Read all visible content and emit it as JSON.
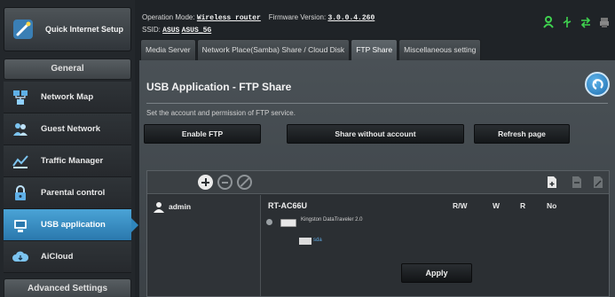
{
  "sidebar": {
    "quick_setup_label": "Quick Internet Setup",
    "general_header": "General",
    "items": [
      {
        "label": "Network Map",
        "icon": "network-map-icon"
      },
      {
        "label": "Guest Network",
        "icon": "guest-network-icon"
      },
      {
        "label": "Traffic Manager",
        "icon": "traffic-manager-icon"
      },
      {
        "label": "Parental control",
        "icon": "parental-control-icon"
      },
      {
        "label": "USB application",
        "icon": "usb-application-icon",
        "active": true
      },
      {
        "label": "AiCloud",
        "icon": "aicloud-icon"
      }
    ],
    "advanced_header": "Advanced Settings"
  },
  "header": {
    "op_mode_label": "Operation Mode:",
    "op_mode_value": "Wireless router",
    "firmware_label": "Firmware Version:",
    "firmware_value": "3.0.0.4.260",
    "ssid_label": "SSID:",
    "ssid_1": "ASUS",
    "ssid_2": "ASUS_5G",
    "status_icons": [
      "user-status-icon",
      "usb-status-icon",
      "network-status-icon",
      "printer-status-icon"
    ]
  },
  "tabs": [
    {
      "label": "Media Server"
    },
    {
      "label": "Network Place(Samba) Share / Cloud Disk"
    },
    {
      "label": "FTP Share",
      "active": true
    },
    {
      "label": "Miscellaneous setting"
    }
  ],
  "main": {
    "title": "USB Application - FTP Share",
    "description": "Set the account and permission of FTP service.",
    "enable_ftp_label": "Enable FTP",
    "share_without_account_label": "Share without account",
    "refresh_label": "Refresh page",
    "apply_label": "Apply"
  },
  "accounts": {
    "users": [
      "admin"
    ],
    "device_name": "RT-AC66U",
    "permission_headers": [
      "R/W",
      "W",
      "R",
      "No"
    ],
    "drive_label": "Kingston DataTraveler 2.0",
    "folder_label": "sda"
  },
  "colors": {
    "accent_blue": "#2a78ad",
    "background": "#1f2327",
    "panel": "#3b4146"
  }
}
